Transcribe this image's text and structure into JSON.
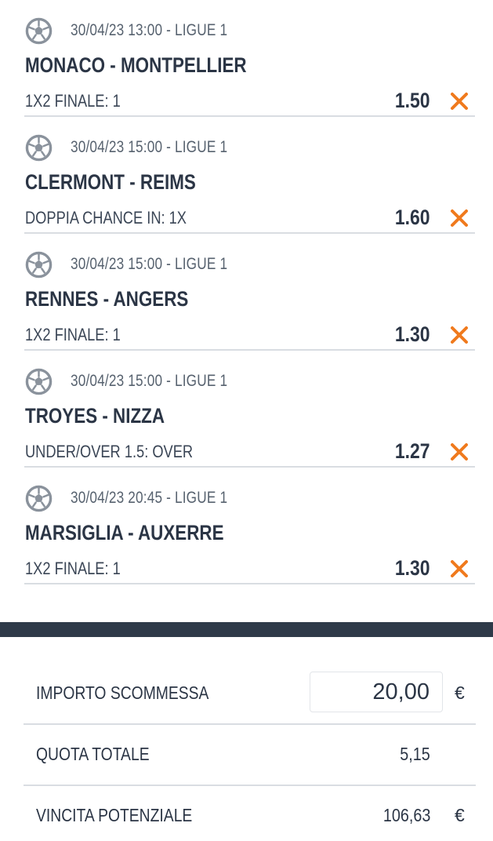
{
  "bets": [
    {
      "meta": "30/04/23 13:00 - LIGUE 1",
      "teams": "MONACO - MONTPELLIER",
      "market": "1X2 FINALE: 1",
      "odds": "1.50"
    },
    {
      "meta": "30/04/23 15:00 - LIGUE 1",
      "teams": "CLERMONT - REIMS",
      "market": "DOPPIA CHANCE IN: 1X",
      "odds": "1.60"
    },
    {
      "meta": "30/04/23 15:00 - LIGUE 1",
      "teams": "RENNES - ANGERS",
      "market": "1X2 FINALE: 1",
      "odds": "1.30"
    },
    {
      "meta": "30/04/23 15:00 - LIGUE 1",
      "teams": "TROYES - NIZZA",
      "market": "UNDER/OVER 1.5: OVER",
      "odds": "1.27"
    },
    {
      "meta": "30/04/23 20:45 - LIGUE 1",
      "teams": "MARSIGLIA - AUXERRE",
      "market": "1X2 FINALE: 1",
      "odds": "1.30"
    }
  ],
  "icons": {
    "sport": "soccer-ball-icon",
    "remove": "close-x-icon"
  },
  "colors": {
    "accent": "#f07a1d",
    "text": "#2b3545",
    "band": "#2f3a49",
    "divider": "#d9dde2"
  },
  "summary": {
    "stake_label": "IMPORTO SCOMMESSA",
    "stake_value": "20,00",
    "stake_currency": "€",
    "total_odds_label": "QUOTA TOTALE",
    "total_odds_value": "5,15",
    "potential_win_label": "VINCITA POTENZIALE",
    "potential_win_value": "106,63",
    "potential_win_currency": "€"
  }
}
